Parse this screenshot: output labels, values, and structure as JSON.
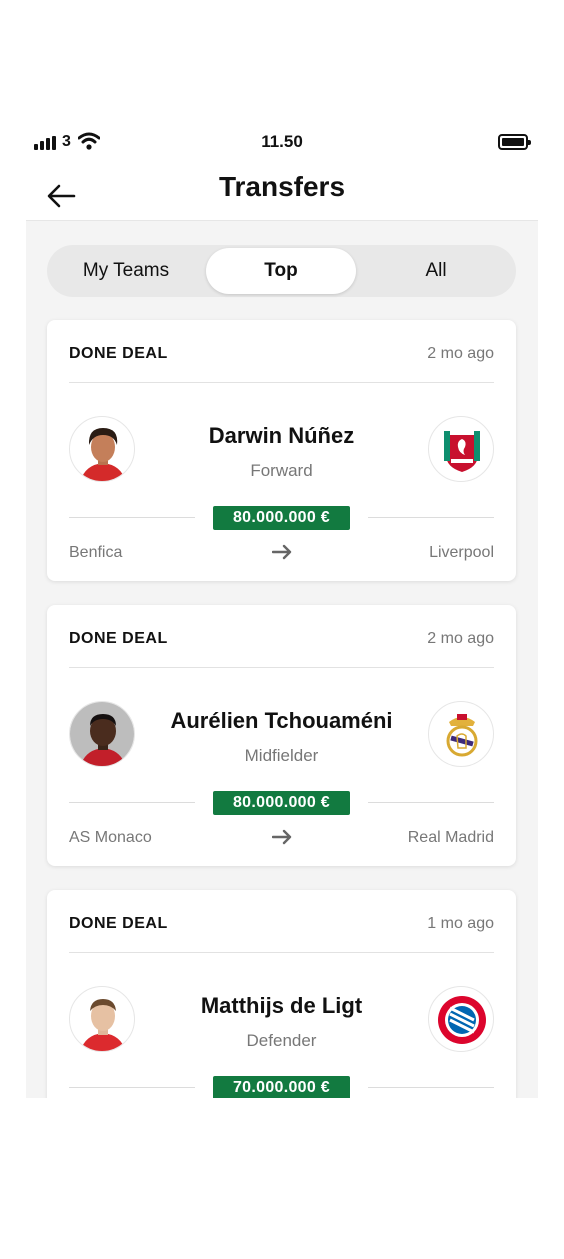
{
  "status_bar": {
    "carrier": "3",
    "time": "11.50"
  },
  "header": {
    "title": "Transfers"
  },
  "tabs": [
    {
      "label": "My Teams",
      "selected": false
    },
    {
      "label": "Top",
      "selected": true
    },
    {
      "label": "All",
      "selected": false
    }
  ],
  "colors": {
    "fee_badge": "#127a40",
    "background": "#f4f4f4"
  },
  "transfers": [
    {
      "status": "DONE DEAL",
      "time": "2 mo ago",
      "player": "Darwin Núñez",
      "position": "Forward",
      "fee": "80.000.000 €",
      "from": "Benfica",
      "to": "Liverpool",
      "to_badge": "liverpool-crest-icon"
    },
    {
      "status": "DONE DEAL",
      "time": "2 mo ago",
      "player": "Aurélien Tchouaméni",
      "position": "Midfielder",
      "fee": "80.000.000 €",
      "from": "AS Monaco",
      "to": "Real Madrid",
      "to_badge": "real-madrid-crest-icon"
    },
    {
      "status": "DONE DEAL",
      "time": "1 mo ago",
      "player": "Matthijs de Ligt",
      "position": "Defender",
      "fee": "70.000.000 €",
      "from": "",
      "to": "",
      "to_badge": "bayern-munchen-crest-icon"
    }
  ]
}
